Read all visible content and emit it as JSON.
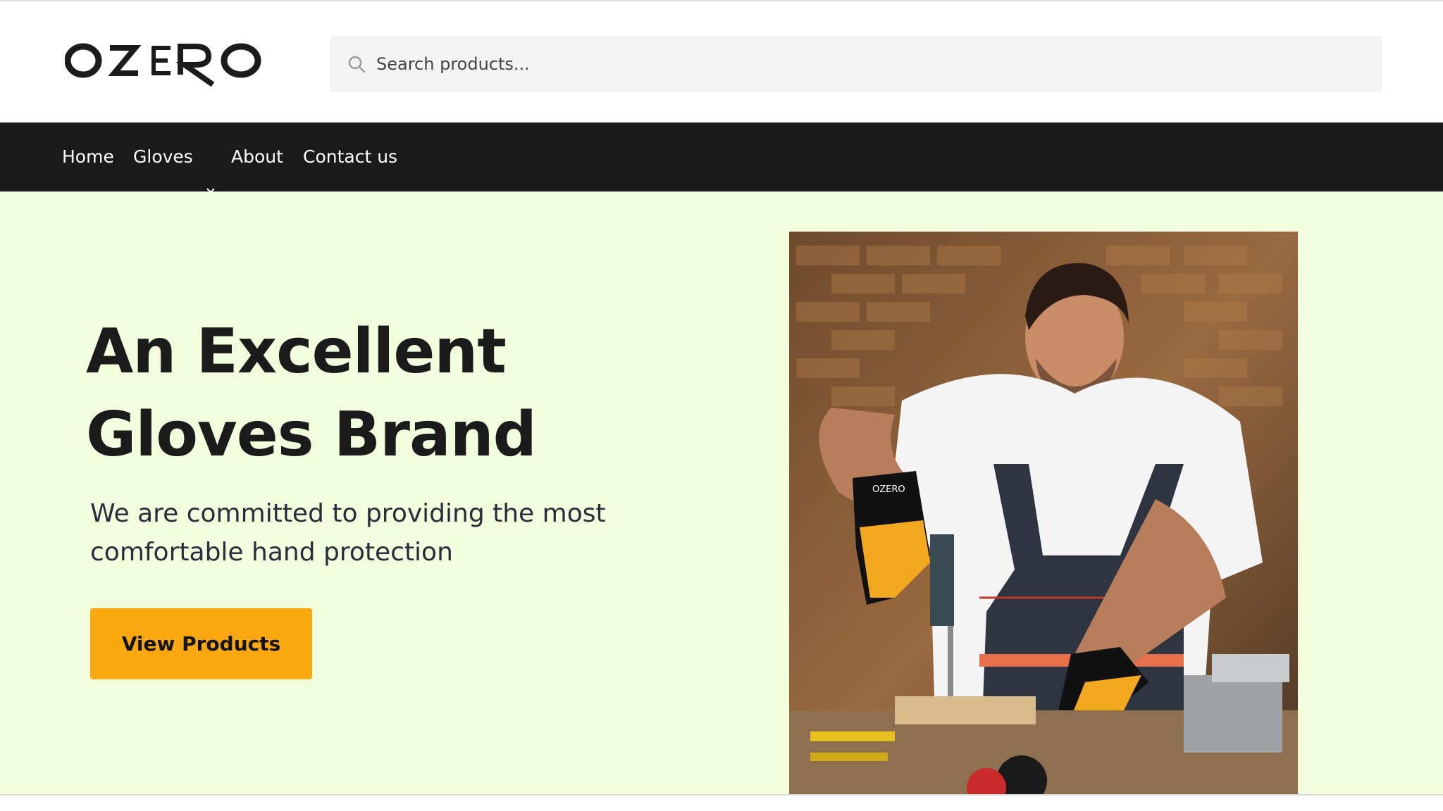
{
  "brand": {
    "logo_text": "OZERO"
  },
  "search": {
    "placeholder": "Search products..."
  },
  "nav": {
    "items": [
      {
        "label": "Home"
      },
      {
        "label": "Gloves",
        "has_dropdown": true
      },
      {
        "label": "About"
      },
      {
        "label": "Contact us"
      }
    ]
  },
  "hero": {
    "title": "An Excellent Gloves Brand",
    "subtitle": "We are committed to providing the most comfortable hand protection",
    "cta_label": "View Products",
    "image_glove_text": "OZERO"
  },
  "colors": {
    "nav_bg": "#1a1a1a",
    "hero_bg": "#f2fdde",
    "cta_bg": "#f9a80f",
    "search_bg": "#f3f3f3"
  },
  "icons": {
    "search": "search-icon",
    "dropdown": "chevron-down-icon"
  }
}
